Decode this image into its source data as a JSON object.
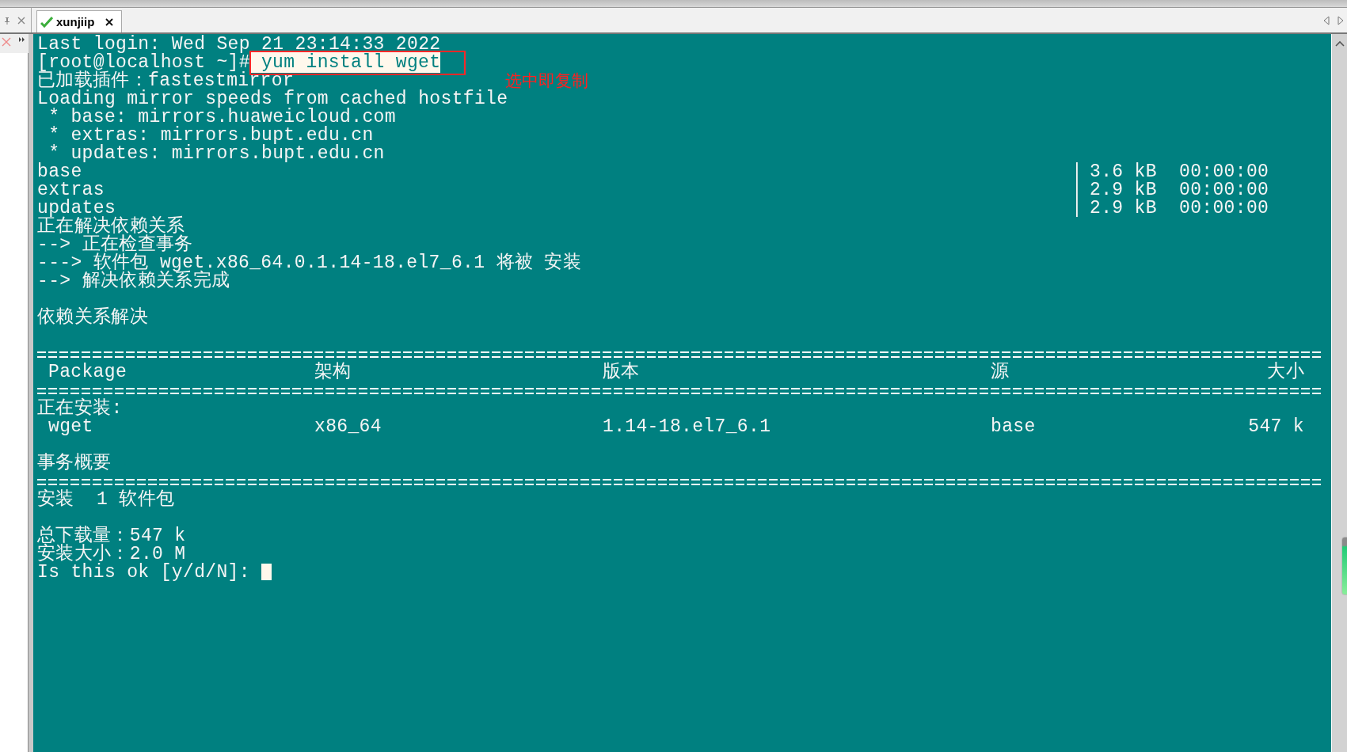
{
  "tabs": [
    {
      "label": "xunjiip",
      "selected": true,
      "connected": true
    }
  ],
  "terminal": {
    "lines": [
      {
        "kind": "text",
        "text": "Last login: Wed Sep 21 23:14:33 2022"
      },
      {
        "kind": "prompt",
        "prompt": "[root@localhost ~]#",
        "command": "yum install wget",
        "selected": true
      },
      {
        "kind": "text",
        "text": "已加载插件：fastestmirror"
      },
      {
        "kind": "text",
        "text": "Loading mirror speeds from cached hostfile"
      },
      {
        "kind": "text",
        "text": " * base: mirrors.huaweicloud.com"
      },
      {
        "kind": "text",
        "text": " * extras: mirrors.bupt.edu.cn"
      },
      {
        "kind": "text",
        "text": " * updates: mirrors.bupt.edu.cn"
      },
      {
        "kind": "repo",
        "name": "base",
        "bar": "|",
        "size": "3.6 kB",
        "time": "00:00:00"
      },
      {
        "kind": "repo",
        "name": "extras",
        "bar": "|",
        "size": "2.9 kB",
        "time": "00:00:00"
      },
      {
        "kind": "repo",
        "name": "updates",
        "bar": "|",
        "size": "2.9 kB",
        "time": "00:00:00"
      },
      {
        "kind": "text",
        "text": "正在解决依赖关系"
      },
      {
        "kind": "text",
        "text": "--> 正在检查事务"
      },
      {
        "kind": "text",
        "text": "---> 软件包 wget.x86_64.0.1.14-18.el7_6.1 将被 安装"
      },
      {
        "kind": "text",
        "text": "--> 解决依赖关系完成"
      },
      {
        "kind": "blank"
      },
      {
        "kind": "text",
        "text": "依赖关系解决"
      },
      {
        "kind": "blank"
      },
      {
        "kind": "rule"
      },
      {
        "kind": "row",
        "cells": [
          "Package",
          "架构",
          "版本",
          "源",
          "大小"
        ]
      },
      {
        "kind": "rule"
      },
      {
        "kind": "text",
        "text": "正在安装:"
      },
      {
        "kind": "row",
        "cells": [
          "wget",
          "x86_64",
          "1.14-18.el7_6.1",
          "base",
          "547 k"
        ]
      },
      {
        "kind": "blank"
      },
      {
        "kind": "text",
        "text": "事务概要"
      },
      {
        "kind": "rule"
      },
      {
        "kind": "text",
        "text": "安装  1 软件包"
      },
      {
        "kind": "blank"
      },
      {
        "kind": "text",
        "text": "总下载量：547 k"
      },
      {
        "kind": "text",
        "text": "安装大小：2.0 M"
      },
      {
        "kind": "input",
        "text": "Is this ok [y/d/N]:",
        "cursor": true
      }
    ]
  },
  "annotation": {
    "label": "选中即复制"
  }
}
